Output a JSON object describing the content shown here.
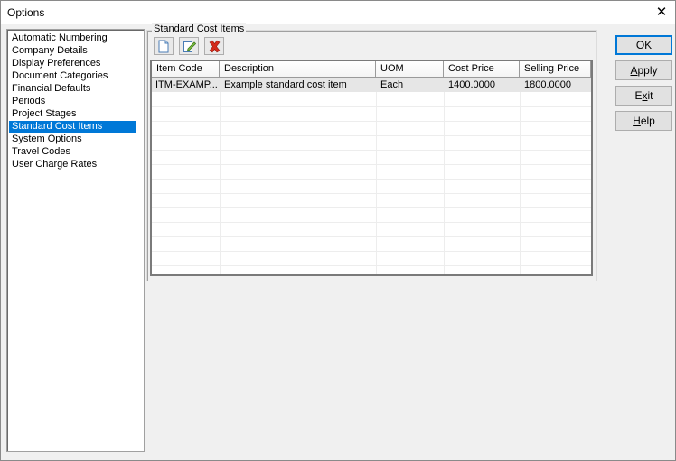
{
  "window": {
    "title": "Options",
    "close_glyph": "✕"
  },
  "categories": {
    "items": [
      "Automatic Numbering",
      "Company Details",
      "Display Preferences",
      "Document Categories",
      "Financial Defaults",
      "Periods",
      "Project Stages",
      "Standard Cost Items",
      "System Options",
      "Travel Codes",
      "User Charge Rates"
    ],
    "selected_index": 7
  },
  "group": {
    "label": "Standard Cost Items",
    "toolbar": {
      "new_icon": "new-item-icon",
      "edit_icon": "edit-item-icon",
      "delete_icon": "delete-item-icon"
    }
  },
  "grid": {
    "columns": [
      "Item Code",
      "Description",
      "UOM",
      "Cost Price",
      "Selling Price"
    ],
    "rows": [
      [
        "ITM-EXAMP...",
        "Example standard cost item",
        "Each",
        "1400.0000",
        "1800.0000"
      ]
    ]
  },
  "buttons": {
    "ok": "OK",
    "apply_pre": "",
    "apply_u": "A",
    "apply_post": "pply",
    "exit_pre": "E",
    "exit_u": "x",
    "exit_post": "it",
    "help_pre": "",
    "help_u": "H",
    "help_post": "elp"
  },
  "colors": {
    "selection": "#0078d7",
    "default_button_border": "#0078d7",
    "delete_icon": "#d42a1a"
  }
}
